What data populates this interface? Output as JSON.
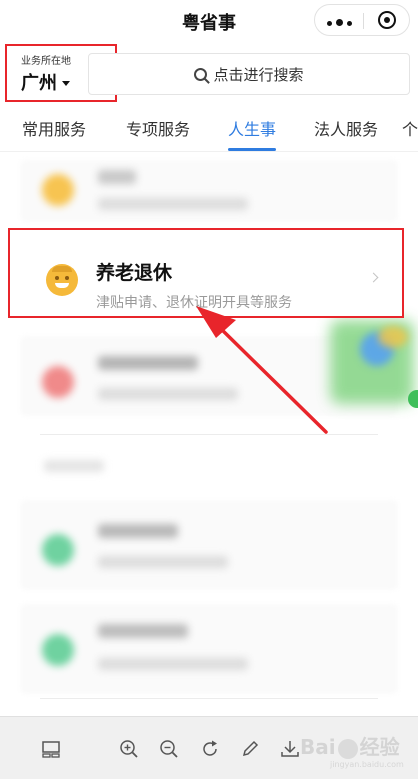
{
  "header": {
    "title": "粤省事"
  },
  "location": {
    "label": "业务所在地",
    "city": "广州"
  },
  "search": {
    "placeholder": "点击进行搜索"
  },
  "tabs": [
    {
      "label": "常用服务",
      "active": false
    },
    {
      "label": "专项服务",
      "active": false
    },
    {
      "label": "人生事",
      "active": true
    },
    {
      "label": "法人服务",
      "active": false
    }
  ],
  "highlighted_item": {
    "title": "养老退休",
    "subtitle": "津贴申请、退休证明开具等服务",
    "icon": "elder-face-icon"
  },
  "toolbar": {
    "icons": [
      "layout-icon",
      "zoom-in-icon",
      "zoom-out-icon",
      "rotate-icon",
      "pencil-icon",
      "download-icon"
    ]
  },
  "watermark": {
    "text": "Bai",
    "text2": "经验",
    "sub": "jingyan.baidu.com"
  },
  "colors": {
    "accent": "#2f7ce0",
    "annotation_red": "#e8252b",
    "icon_yellow": "#f5b93a"
  }
}
